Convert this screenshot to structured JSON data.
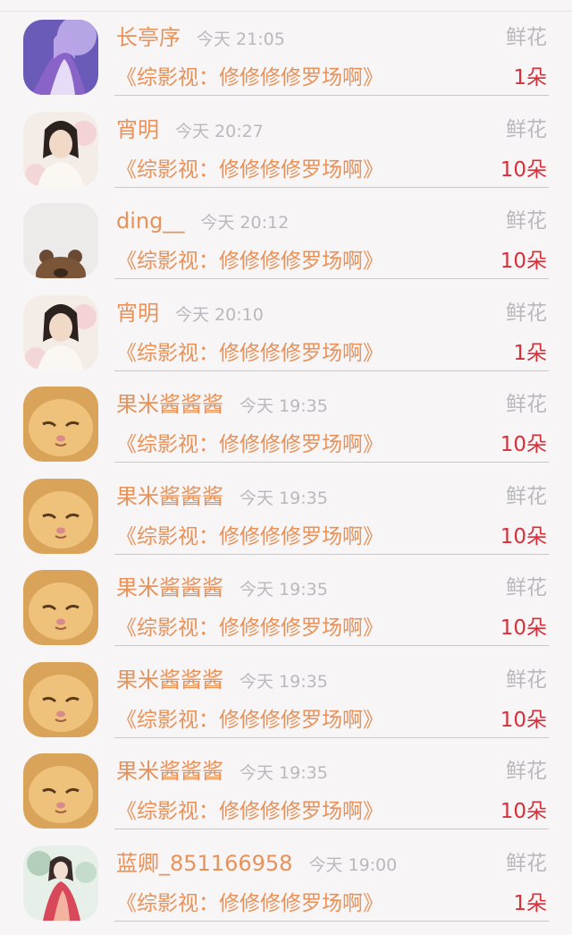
{
  "rows": [
    {
      "avatar": "fantasy-costume-avatar",
      "name": "长亭序",
      "time": "今天 21:05",
      "gift": "鲜花",
      "title": "《综影视：修修修修罗场啊》",
      "count": "1朵"
    },
    {
      "avatar": "young-man-avatar",
      "name": "宵明",
      "time": "今天 20:27",
      "gift": "鲜花",
      "title": "《综影视：修修修修罗场啊》",
      "count": "10朵"
    },
    {
      "avatar": "teddy-bear-avatar",
      "name": "ding__",
      "time": "今天 20:12",
      "gift": "鲜花",
      "title": "《综影视：修修修修罗场啊》",
      "count": "10朵"
    },
    {
      "avatar": "young-man-avatar",
      "name": "宵明",
      "time": "今天 20:10",
      "gift": "鲜花",
      "title": "《综影视：修修修修罗场啊》",
      "count": "1朵"
    },
    {
      "avatar": "kitten-avatar",
      "name": "果米酱酱酱",
      "time": "今天 19:35",
      "gift": "鲜花",
      "title": "《综影视：修修修修罗场啊》",
      "count": "10朵"
    },
    {
      "avatar": "kitten-avatar",
      "name": "果米酱酱酱",
      "time": "今天 19:35",
      "gift": "鲜花",
      "title": "《综影视：修修修修罗场啊》",
      "count": "10朵"
    },
    {
      "avatar": "kitten-avatar",
      "name": "果米酱酱酱",
      "time": "今天 19:35",
      "gift": "鲜花",
      "title": "《综影视：修修修修罗场啊》",
      "count": "10朵"
    },
    {
      "avatar": "kitten-avatar",
      "name": "果米酱酱酱",
      "time": "今天 19:35",
      "gift": "鲜花",
      "title": "《综影视：修修修修罗场啊》",
      "count": "10朵"
    },
    {
      "avatar": "kitten-avatar",
      "name": "果米酱酱酱",
      "time": "今天 19:35",
      "gift": "鲜花",
      "title": "《综影视：修修修修罗场啊》",
      "count": "10朵"
    },
    {
      "avatar": "painted-lady-avatar",
      "name": "蓝卿_851166958",
      "time": "今天 19:00",
      "gift": "鲜花",
      "title": "《综影视：修修修修罗场啊》",
      "count": "1朵"
    }
  ],
  "colors": {
    "name": "#e8925a",
    "count": "#d6303a",
    "muted": "#b9b9bd",
    "background": "#f7f5f6"
  }
}
